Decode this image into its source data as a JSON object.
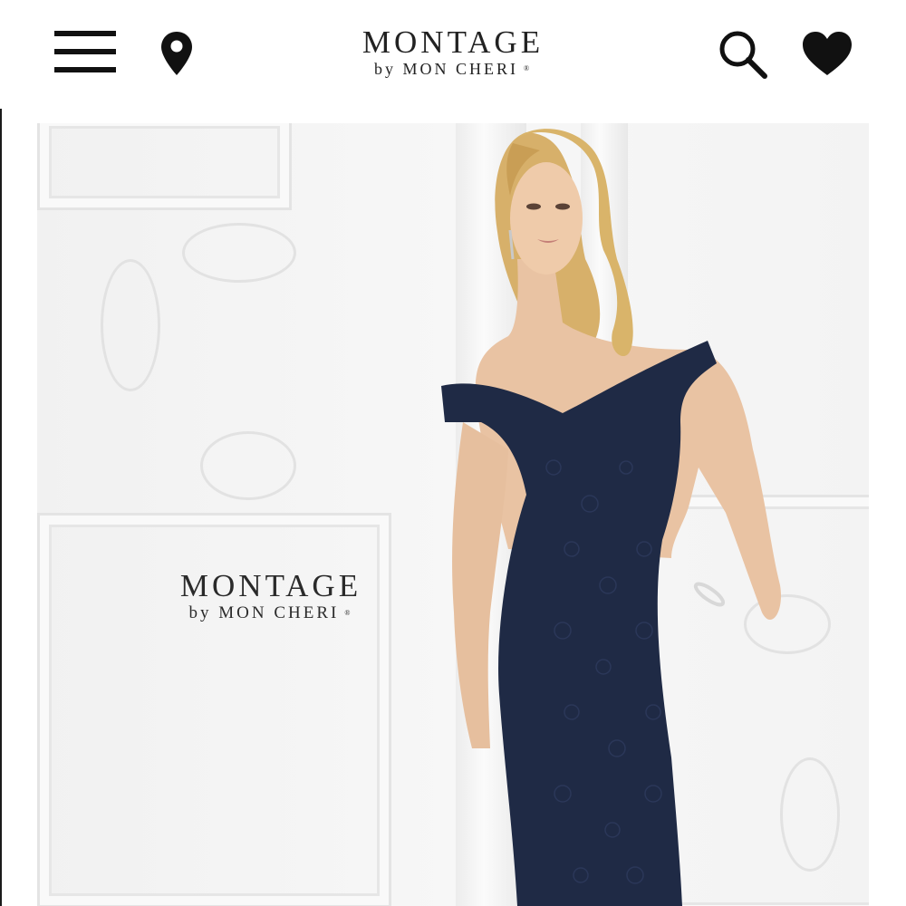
{
  "header": {
    "logo_main": "MONTAGE",
    "logo_sub": "by MON CHERI",
    "logo_mark": "®",
    "icons": [
      "menu-icon",
      "location-pin-icon",
      "search-icon",
      "heart-icon"
    ]
  },
  "hero": {
    "logo_main": "MONTAGE",
    "logo_sub": "by MON CHERI",
    "logo_mark": "®",
    "image": "model-in-navy-lace-off-shoulder-gown"
  },
  "colors": {
    "text": "#111111",
    "dress": "#1f2a45",
    "hair": "#d9b46a",
    "background": "#f4f4f4"
  }
}
